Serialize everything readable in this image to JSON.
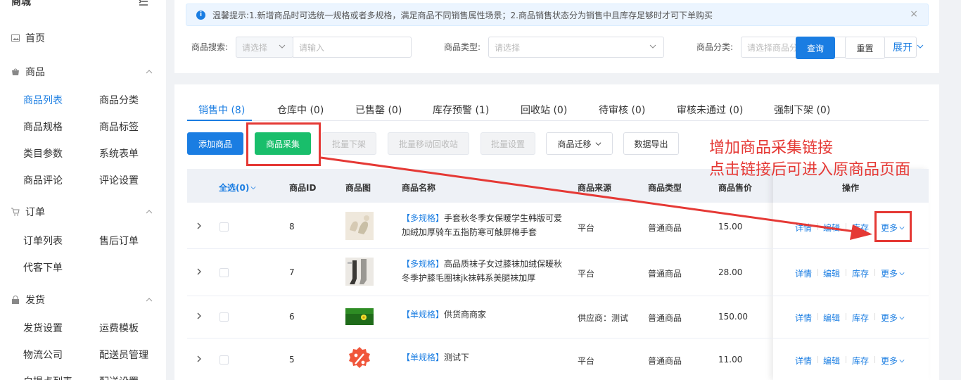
{
  "sidebar": {
    "brand": "商城",
    "groups": [
      {
        "label": "首页"
      },
      {
        "label": "商品"
      },
      {
        "label": "订单"
      },
      {
        "label": "发货"
      }
    ],
    "items": {
      "goods_list": "商品列表",
      "goods_category": "商品分类",
      "goods_spec": "商品规格",
      "goods_tag": "商品标签",
      "category_param": "类目参数",
      "system_form": "系统表单",
      "goods_review": "商品评论",
      "review_settings": "评论设置",
      "order_list": "订单列表",
      "after_sale": "售后订单",
      "proxy_order": "代客下单",
      "ship_settings": "发货设置",
      "freight_template": "运费模板",
      "logistics": "物流公司",
      "courier_mgmt": "配送员管理",
      "pickup_list": "自提点列表",
      "delivery_settings": "配送设置"
    }
  },
  "alert": {
    "text": "温馨提示:1.新增商品时可选统一规格或者多规格，满足商品不同销售属性场景；2.商品销售状态分为销售中且库存足够时才可下单购买"
  },
  "filters": {
    "search_label": "商品搜索:",
    "search_select": "请选择",
    "search_input": "请输入",
    "type_label": "商品类型:",
    "type_select": "请选择",
    "category_label": "商品分类:",
    "category_select": "请选择商品分",
    "query": "查询",
    "reset": "重置",
    "expand": "展开"
  },
  "tabs": [
    "销售中 (8)",
    "仓库中 (0)",
    "已售罄 (0)",
    "库存预警 (1)",
    "回收站 (0)",
    "待审核 (0)",
    "审核未通过 (0)",
    "强制下架 (0)"
  ],
  "actions": {
    "add": "添加商品",
    "collect": "商品采集",
    "batch_off": "批量下架",
    "batch_recycle": "批量移动回收站",
    "batch_settings": "批量设置",
    "migrate": "商品迁移",
    "export": "数据导出"
  },
  "table": {
    "headers": {
      "select_all": "全选(0)",
      "id": "商品ID",
      "image": "商品图",
      "name": "商品名称",
      "source": "商品来源",
      "type": "商品类型",
      "price": "商品售价",
      "ops": "操作"
    },
    "rows": [
      {
        "id": "8",
        "tag": "【多规格】",
        "name": "手套秋冬季女保暖学生韩版可爱加绒加厚骑车五指防寒可触屏棉手套",
        "source": "平台",
        "type": "普通商品",
        "price": "15.00"
      },
      {
        "id": "7",
        "tag": "【多规格】",
        "name": "高品质袜子女过膝袜加绒保暖秋冬季护膝毛圈袜jk袜韩系美腿袜加厚",
        "source": "平台",
        "type": "普通商品",
        "price": "28.00"
      },
      {
        "id": "6",
        "tag": "【单规格】",
        "name": "供货商商家",
        "source": "供应商：测试",
        "type": "普通商品",
        "price": "150.00"
      },
      {
        "id": "5",
        "tag": "【单规格】",
        "name": "测试下",
        "source": "平台",
        "type": "普通商品",
        "price": "11.00"
      }
    ],
    "ops": {
      "detail": "详情",
      "edit": "编辑",
      "stock": "库存",
      "more": "更多"
    }
  },
  "annotation": {
    "line1": "增加商品采集链接",
    "line2": "点击链接后可进入原商品页面"
  },
  "colors": {
    "primary": "#1a7de2",
    "success": "#19be6b",
    "annotation": "#e53935"
  }
}
